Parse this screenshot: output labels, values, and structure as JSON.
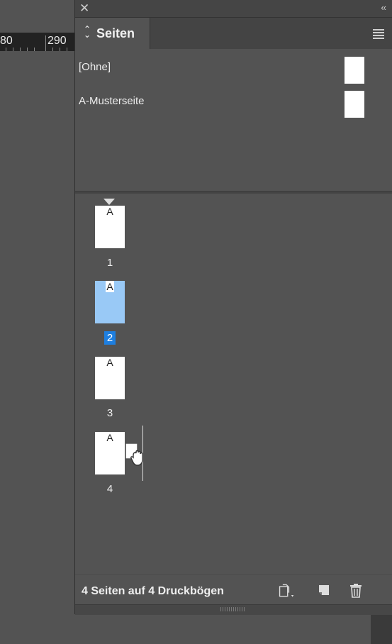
{
  "ruler": {
    "labels": [
      "80",
      "290"
    ]
  },
  "panel": {
    "tab_label": "Seiten",
    "masters": [
      {
        "name": "[Ohne]"
      },
      {
        "name": "A-Musterseite"
      }
    ],
    "pages": [
      {
        "number": "1",
        "master_letter": "A",
        "selected": false
      },
      {
        "number": "2",
        "master_letter": "A",
        "selected": true
      },
      {
        "number": "3",
        "master_letter": "A",
        "selected": false
      },
      {
        "number": "4",
        "master_letter": "A",
        "selected": false
      }
    ],
    "status": "4 Seiten auf 4 Druckbögen"
  },
  "colors": {
    "selection": "#1e7fe0",
    "selected_page": "#99c9f6",
    "panel_bg": "#535353"
  },
  "icons": [
    "close-icon",
    "collapse-icon",
    "panel-menu-icon",
    "edit-page-size-icon",
    "new-page-icon",
    "delete-page-icon",
    "drag-hand-icon"
  ]
}
